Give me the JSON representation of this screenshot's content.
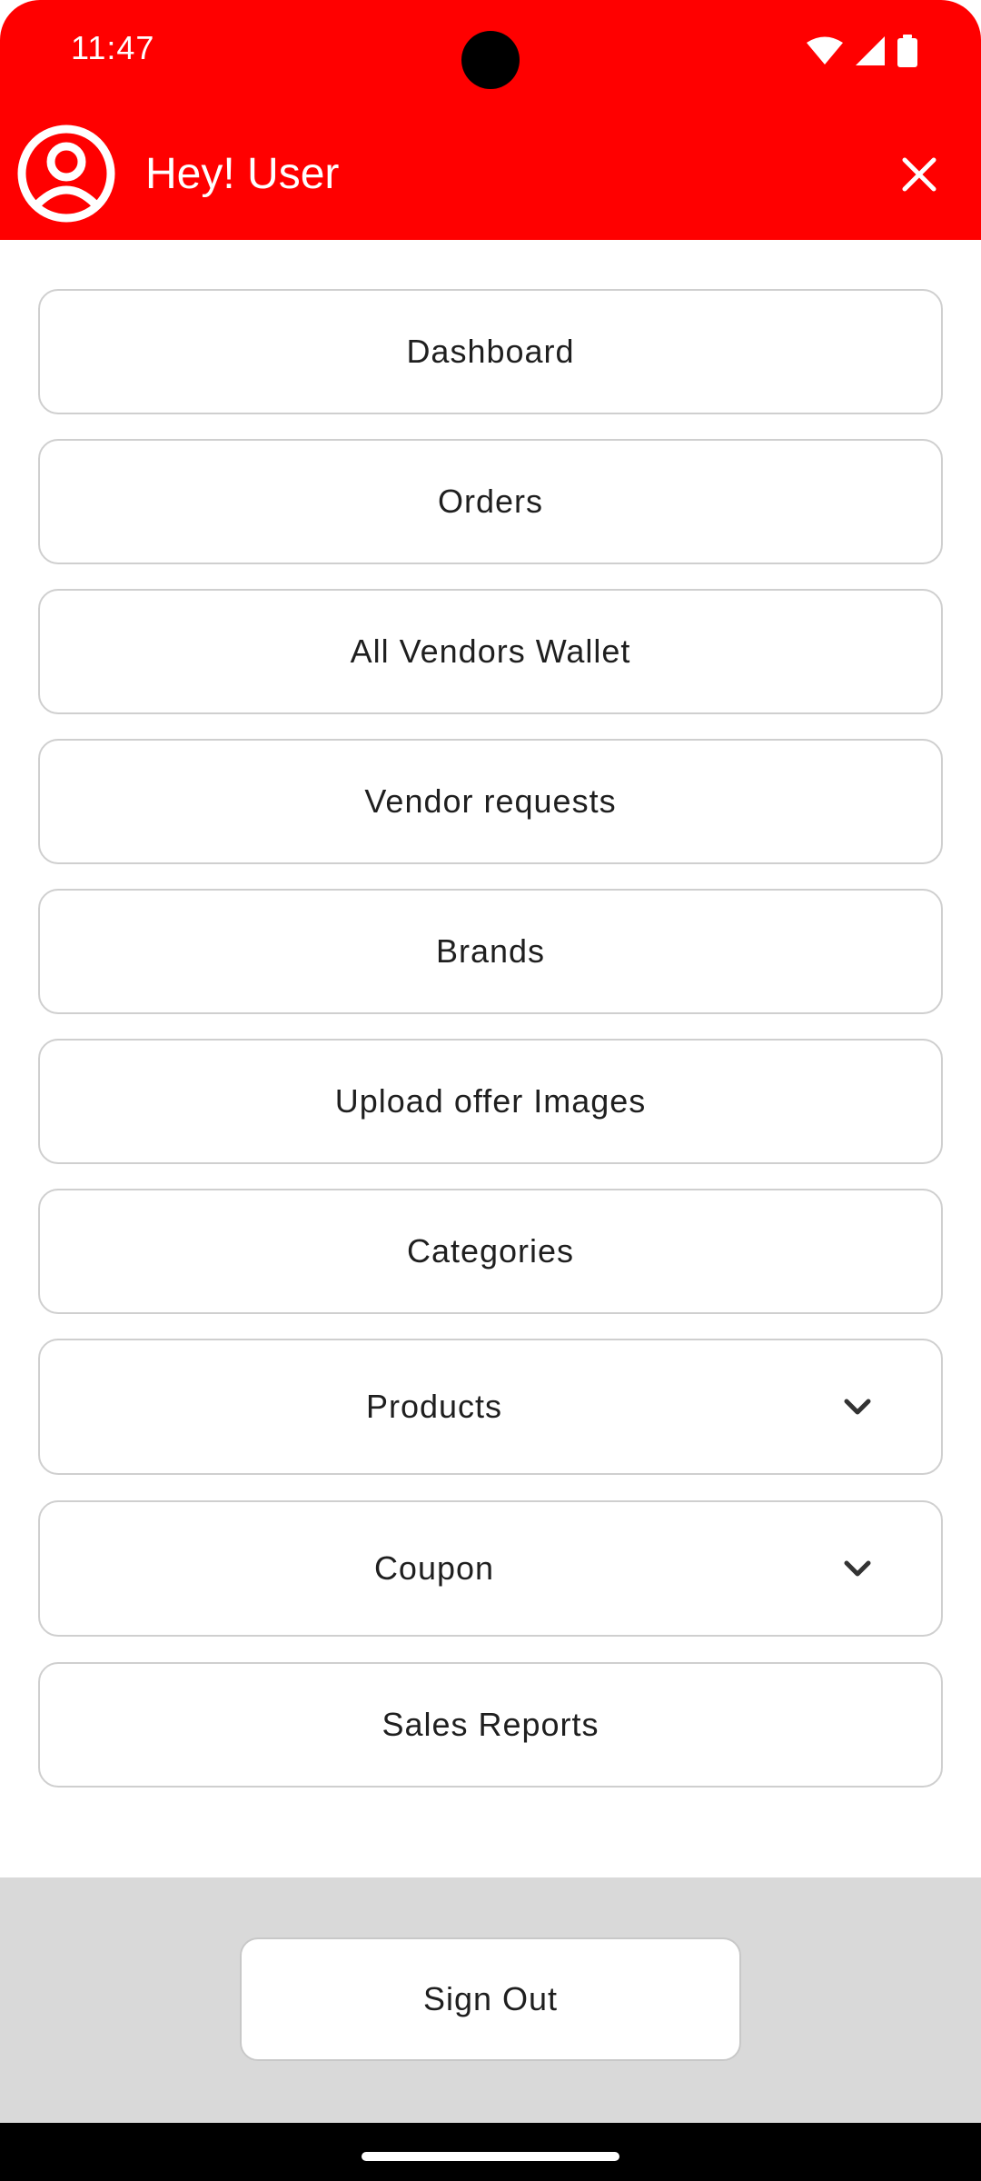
{
  "status_bar": {
    "time": "11:47",
    "icons": [
      "wifi-icon",
      "cellular-signal-icon",
      "battery-icon"
    ]
  },
  "header": {
    "greeting": "Hey! User",
    "avatar_icon": "account-circle-icon",
    "close_icon": "close-icon",
    "background_color": "#ff0000"
  },
  "menu": {
    "items": [
      {
        "label": "Dashboard"
      },
      {
        "label": "Orders"
      },
      {
        "label": "All Vendors Wallet"
      },
      {
        "label": "Vendor requests"
      },
      {
        "label": "Brands"
      },
      {
        "label": "Upload offer Images"
      },
      {
        "label": "Categories"
      },
      {
        "label": "Products",
        "expandable": true
      },
      {
        "label": "Coupon",
        "expandable": true
      },
      {
        "label": "Sales Reports"
      }
    ]
  },
  "footer": {
    "sign_out_label": "Sign Out"
  }
}
